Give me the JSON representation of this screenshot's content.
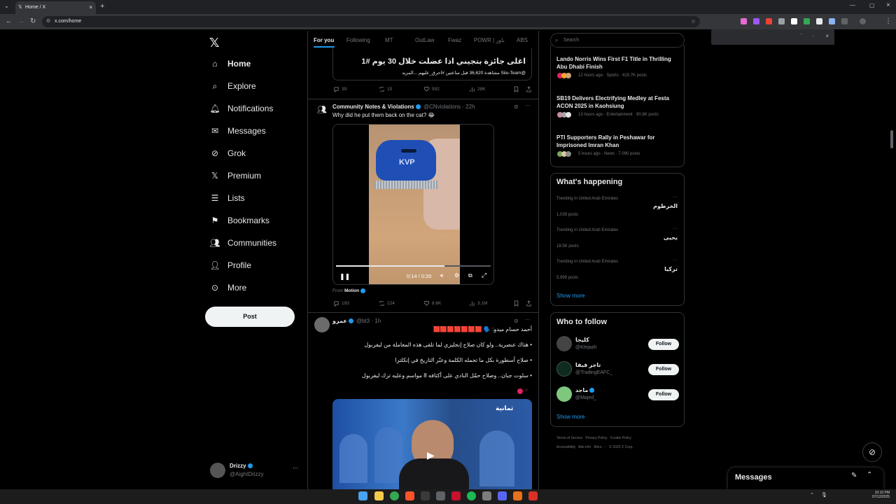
{
  "browser": {
    "tab_title": "Home / X",
    "url": "x.com/home"
  },
  "nav": {
    "items": [
      {
        "label": "Home",
        "icon": "home-icon"
      },
      {
        "label": "Explore",
        "icon": "search-icon"
      },
      {
        "label": "Notifications",
        "icon": "bell-icon"
      },
      {
        "label": "Messages",
        "icon": "mail-icon"
      },
      {
        "label": "Grok",
        "icon": "grok-icon"
      },
      {
        "label": "Premium",
        "icon": "x-logo-icon"
      },
      {
        "label": "Lists",
        "icon": "list-icon"
      },
      {
        "label": "Bookmarks",
        "icon": "bookmark-icon"
      },
      {
        "label": "Communities",
        "icon": "people-icon"
      },
      {
        "label": "Profile",
        "icon": "person-icon"
      },
      {
        "label": "More",
        "icon": "more-circle-icon"
      }
    ],
    "post_label": "Post",
    "account": {
      "name": "Drizzy",
      "handle": "@AightDrizzy"
    }
  },
  "feed": {
    "tabs": [
      "For you",
      "Following",
      "MT",
      "OutLaw",
      "Fwaz",
      "POWR | باور",
      "ABS"
    ],
    "tweet0": {
      "headline": "اغلى جائزة بتجيني اذا عضلت خلال 30 يوم #1",
      "meta": "@Siiu-Team مشاهدة 36,620 قبل ساعتين #احرق_عليهم ...المزيد",
      "replies": "39",
      "reposts": "15",
      "likes": "592",
      "views": "28K"
    },
    "tweet1": {
      "name": "Community Notes & Violations",
      "handle": "@CNviolations",
      "time": "22h",
      "text": "Why did he put them back on the cat? 😂",
      "video_time": "0:14 / 0:20",
      "video_progress": 0.7,
      "brand_text": "KVP",
      "from_label": "From",
      "from_source": "Motion",
      "replies": "193",
      "reposts": "224",
      "likes": "8.6K",
      "views": "3.1M"
    },
    "tweet2": {
      "name": "عمرو",
      "handle": "@bt3",
      "time": "1h",
      "line1": "أحمد حسام ميدو: 🗣️ 🟥🟥🟥🟥🟥🟥🟥",
      "line2": "• هناك عنصرية.. ولو كان صلاح إنجليزي لما تلقى هذه المعاملة من ليفربول",
      "line3": "• صلاح أسطورة بكل ما تحمله الكلمة وعبّر التاريخ في إنكلترا",
      "line4": "• سلوت جبان.. وصلاح حمّل النادي على أكتافه 8 مواسم وعليه ترك ليفربول",
      "video_logo": "ثمانية"
    }
  },
  "sidebar": {
    "search_placeholder": "Search",
    "news": [
      {
        "title": "Lando Norris Wins First F1 Title in Thrilling Abu Dhabi Finish",
        "meta": "12 hours ago · Sports · 415.7K posts"
      },
      {
        "title": "SB19 Delivers Electrifying Medley at Festa ACON 2025 in Kaohsiung",
        "meta": "13 hours ago · Entertainment · 90.8K posts"
      },
      {
        "title": "PTI Supporters Rally in Peshawar for Imprisoned Imran Khan",
        "meta": "5 hours ago · News · 7,090 posts"
      }
    ],
    "happening_title": "What's happening",
    "trends": [
      {
        "context": "Trending in United Arab Emirates",
        "name": "الخرطوم",
        "posts": "1,039 posts"
      },
      {
        "context": "Trending in United Arab Emirates",
        "name": "يحيى",
        "posts": "18.5K posts"
      },
      {
        "context": "Trending in United Arab Emirates",
        "name": "تركيا",
        "posts": "5,999 posts"
      }
    ],
    "show_more": "Show more",
    "who_title": "Who to follow",
    "follow_label": "Follow",
    "follows": [
      {
        "name": "كليجا",
        "handle": "@Klejaah"
      },
      {
        "name": "تاجر فيفا",
        "handle": "@TradingEAFC_"
      },
      {
        "name": "ماجد",
        "handle": "@Majed_"
      }
    ],
    "footer1": "Terms of Service   Privacy Policy   Cookie Policy",
    "footer2": "Accessibility   Ads info   More ···   © 2025 X Corp."
  },
  "messages_drawer": {
    "label": "Messages"
  },
  "taskbar": {
    "time": "10:10 PM",
    "date": "07/12/2025"
  }
}
